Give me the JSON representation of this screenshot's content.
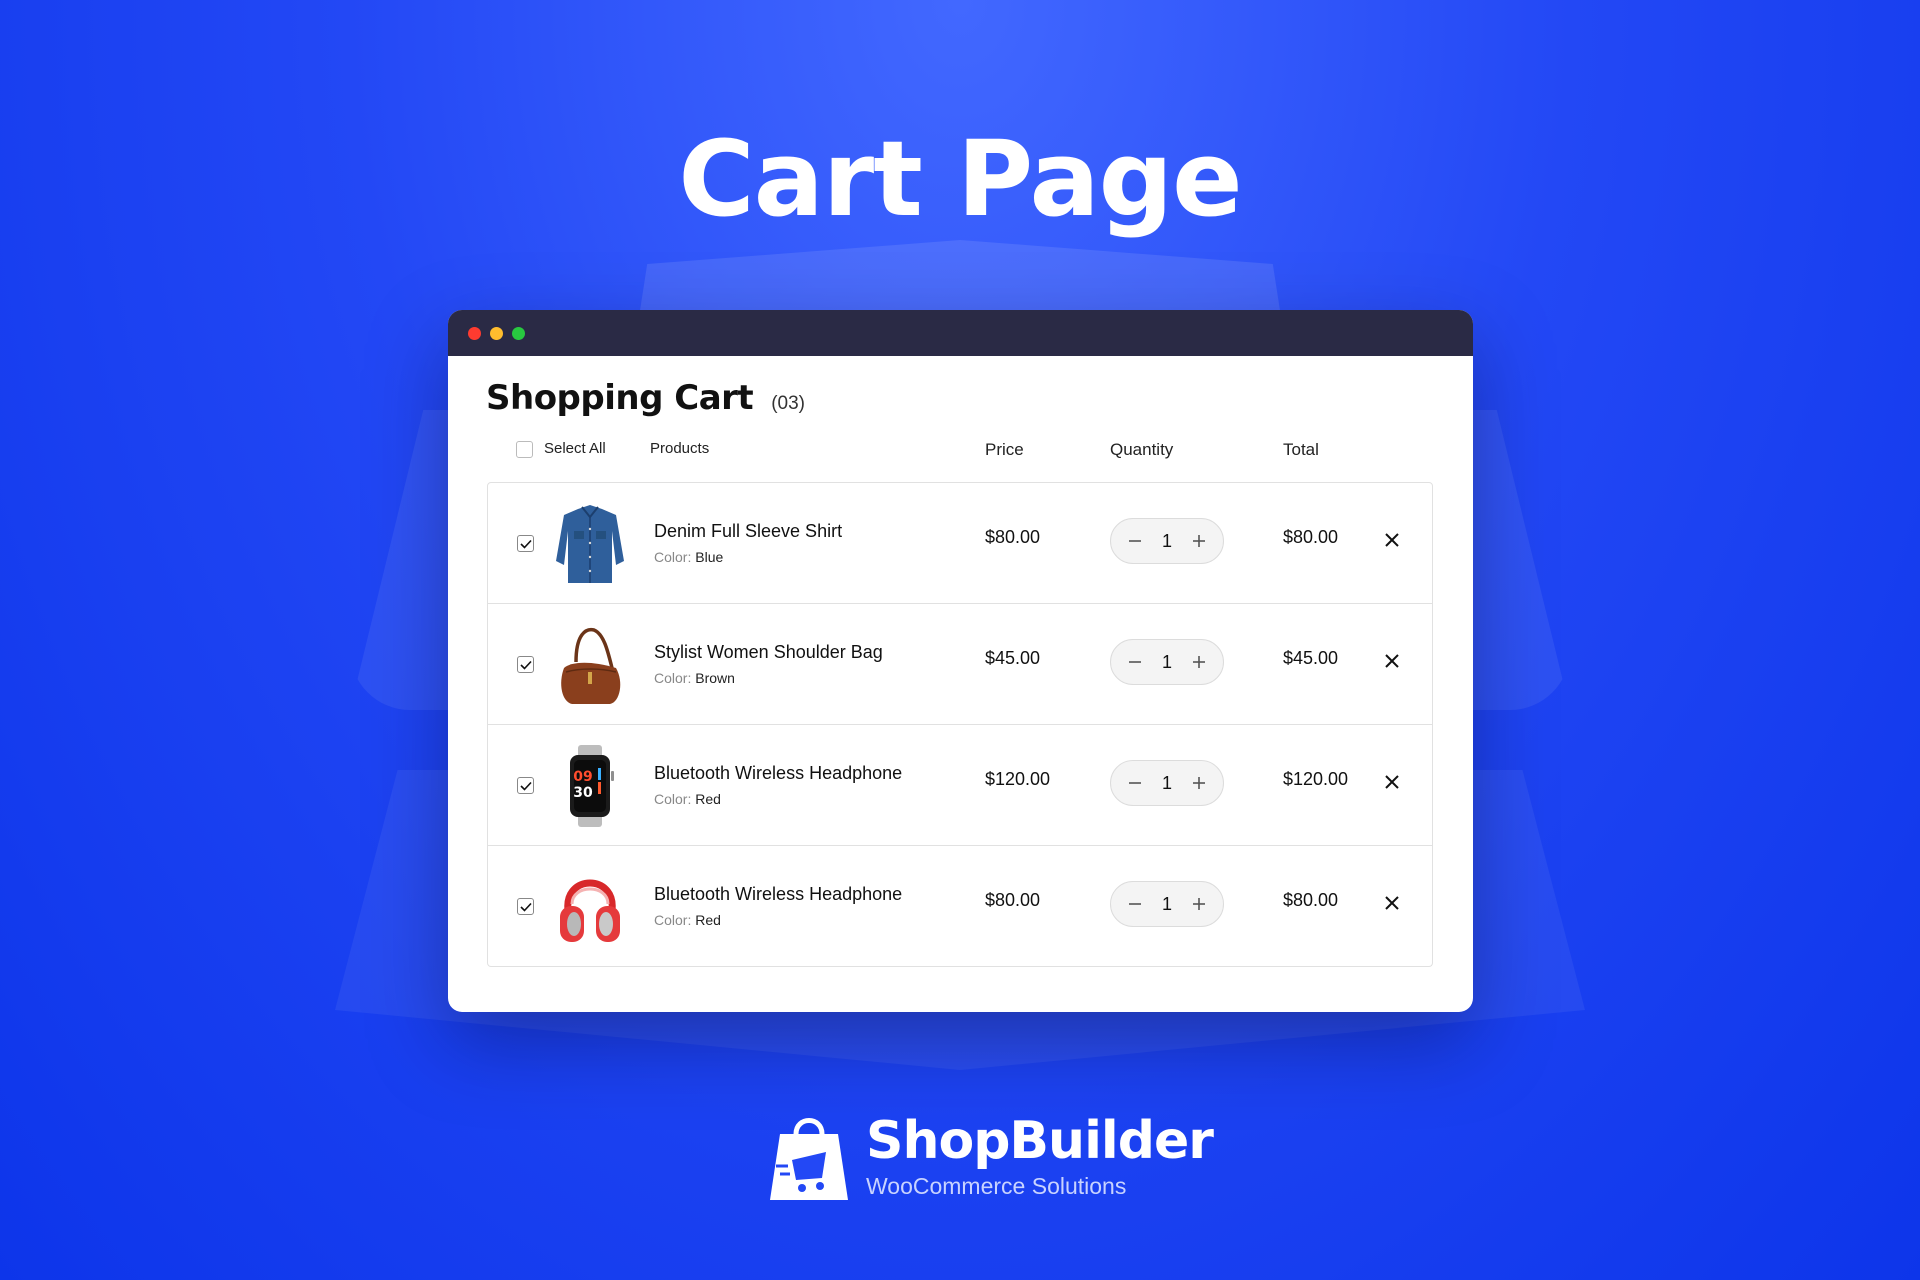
{
  "hero": {
    "title": "Cart Page"
  },
  "window": {
    "dots": [
      "#ff3b30",
      "#ffbd2e",
      "#28c840"
    ]
  },
  "cart": {
    "title": "Shopping Cart",
    "count": "(03)",
    "columns": {
      "select_all": "Select All",
      "products": "Products",
      "price": "Price",
      "quantity": "Quantity",
      "total": "Total"
    },
    "items": [
      {
        "name": "Denim Full Sleeve Shirt",
        "variant_label": "Color:",
        "variant_value": "Blue",
        "price": "$80.00",
        "quantity": "1",
        "total": "$80.00",
        "checked": true,
        "image_icon": "denim-shirt"
      },
      {
        "name": "Stylist Women Shoulder Bag",
        "variant_label": "Color:",
        "variant_value": "Brown",
        "price": "$45.00",
        "quantity": "1",
        "total": "$45.00",
        "checked": true,
        "image_icon": "shoulder-bag"
      },
      {
        "name": "Bluetooth Wireless Headphone",
        "variant_label": "Color:",
        "variant_value": "Red",
        "price": "$120.00",
        "quantity": "1",
        "total": "$120.00",
        "checked": true,
        "image_icon": "smartwatch",
        "watch_hour": "09",
        "watch_minute": "30"
      },
      {
        "name": "Bluetooth Wireless Headphone",
        "variant_label": "Color:",
        "variant_value": "Red",
        "price": "$80.00",
        "quantity": "1",
        "total": "$80.00",
        "checked": true,
        "image_icon": "headphones"
      }
    ]
  },
  "brand": {
    "name": "ShopBuilder",
    "tagline": "WooCommerce Solutions",
    "icon": "shopping-bag-cart-logo"
  }
}
